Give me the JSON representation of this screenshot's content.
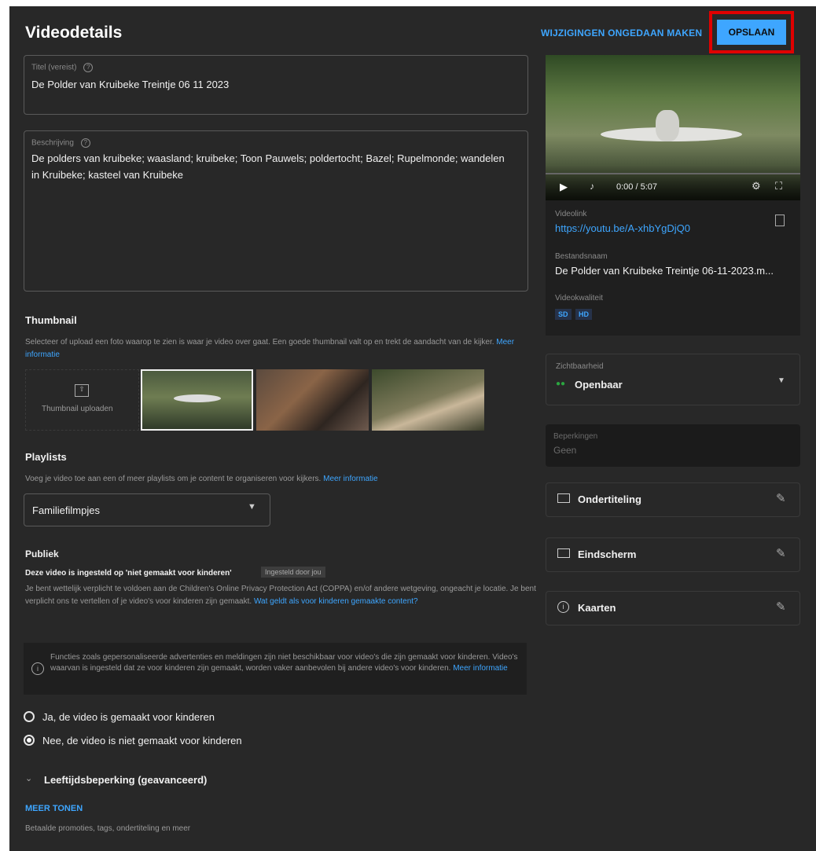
{
  "header": {
    "title": "Videodetails",
    "undo_label": "WIJZIGINGEN ONGEDAAN MAKEN",
    "save_label": "OPSLAAN"
  },
  "title_field": {
    "label": "Titel (vereist)",
    "value": "De Polder van Kruibeke Treintje 06 11 2023"
  },
  "description_field": {
    "label": "Beschrijving",
    "value": "De polders van kruibeke; waasland; kruibeke; Toon Pauwels; poldertocht; Bazel; Rupelmonde; wandelen in Kruibeke; kasteel van Kruibeke"
  },
  "thumbnail": {
    "heading": "Thumbnail",
    "description": "Selecteer of upload een foto waarop te zien is waar je video over gaat. Een goede thumbnail valt op en trekt de aandacht van de kijker.",
    "more_info": "Meer informatie",
    "upload_label": "Thumbnail uploaden"
  },
  "playlists": {
    "heading": "Playlists",
    "description": "Voeg je video toe aan een of meer playlists om je content te organiseren voor kijkers.",
    "more_info": "Meer informatie",
    "selected": "Familiefilmpjes"
  },
  "audience": {
    "heading": "Publiek",
    "status": "Deze video is ingesteld op 'niet gemaakt voor kinderen'",
    "badge": "Ingesteld door jou",
    "legal_text": "Je bent wettelijk verplicht te voldoen aan de Children's Online Privacy Protection Act (COPPA) en/of andere wetgeving, ongeacht je locatie. Je bent verplicht ons te vertellen of je video's voor kinderen zijn gemaakt.",
    "legal_link": "Wat geldt als voor kinderen gemaakte content?",
    "info_text": "Functies zoals gepersonaliseerde advertenties en meldingen zijn niet beschikbaar voor video's die zijn gemaakt voor kinderen. Video's waarvan is ingesteld dat ze voor kinderen zijn gemaakt, worden vaker aanbevolen bij andere video's voor kinderen.",
    "info_link": "Meer informatie",
    "option_yes": "Ja, de video is gemaakt voor kinderen",
    "option_no": "Nee, de video is niet gemaakt voor kinderen",
    "selected": "no",
    "age_restriction": "Leeftijdsbeperking (geavanceerd)"
  },
  "more": {
    "label": "MEER TONEN",
    "sub": "Betaalde promoties, tags, ondertiteling en meer"
  },
  "player": {
    "time": "0:00 / 5:07"
  },
  "video_info": {
    "link_label": "Videolink",
    "link": "https://youtu.be/A-xhbYgDjQ0",
    "filename_label": "Bestandsnaam",
    "filename": "De Polder van Kruibeke Treintje 06-11-2023.m...",
    "quality_label": "Videokwaliteit",
    "quality_badges": [
      "SD",
      "HD"
    ]
  },
  "visibility": {
    "label": "Zichtbaarheid",
    "value": "Openbaar"
  },
  "restrictions": {
    "label": "Beperkingen",
    "value": "Geen"
  },
  "side_items": [
    {
      "label": "Ondertiteling"
    },
    {
      "label": "Eindscherm"
    },
    {
      "label": "Kaarten"
    }
  ]
}
